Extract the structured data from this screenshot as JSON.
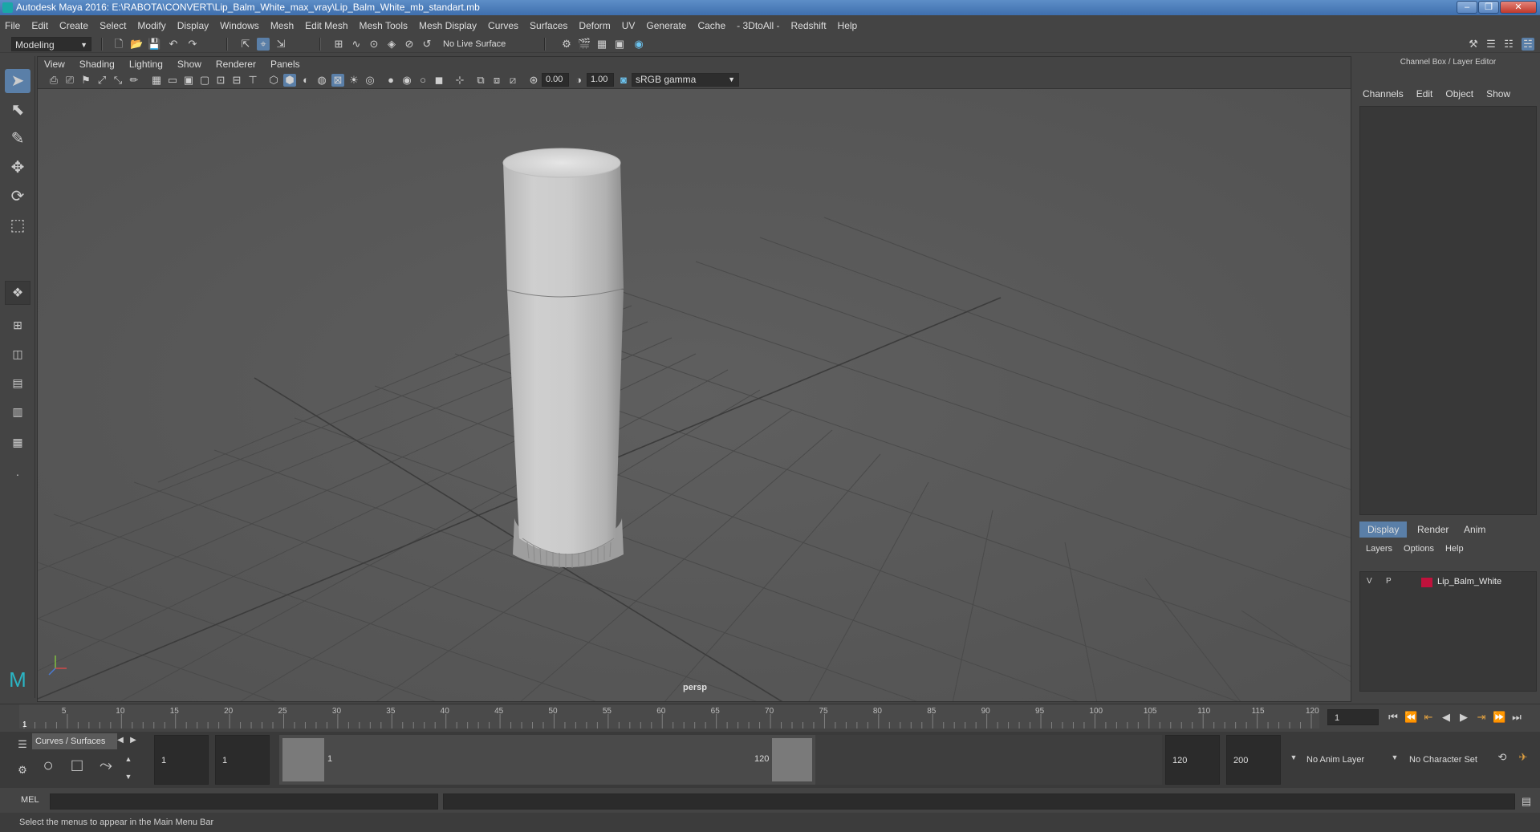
{
  "window": {
    "title": "Autodesk Maya 2016: E:\\RABOTA\\CONVERT\\Lip_Balm_White_max_vray\\Lip_Balm_White_mb_standart.mb"
  },
  "menubar": [
    "File",
    "Edit",
    "Create",
    "Select",
    "Modify",
    "Display",
    "Windows",
    "Mesh",
    "Edit Mesh",
    "Mesh Tools",
    "Mesh Display",
    "Curves",
    "Surfaces",
    "Deform",
    "UV",
    "Generate",
    "Cache",
    "- 3DtoAll -",
    "Redshift",
    "Help"
  ],
  "statusline": {
    "mode": "Modeling",
    "live_surface": "No Live Surface"
  },
  "panel": {
    "menus": [
      "View",
      "Shading",
      "Lighting",
      "Show",
      "Renderer",
      "Panels"
    ],
    "exposure": "0.00",
    "gamma": "1.00",
    "colorspace": "sRGB gamma",
    "camera_label": "persp"
  },
  "channelbox": {
    "header": "Channel Box / Layer Editor",
    "menus": [
      "Channels",
      "Edit",
      "Object",
      "Show"
    ]
  },
  "layers": {
    "tabs": [
      "Display",
      "Render",
      "Anim"
    ],
    "menus": [
      "Layers",
      "Options",
      "Help"
    ],
    "items": [
      {
        "v": "V",
        "p": "P",
        "name": "Lip_Balm_White",
        "color": "#c0123c"
      }
    ]
  },
  "timeline": {
    "ticks": [
      "1",
      "5",
      "10",
      "15",
      "20",
      "25",
      "30",
      "35",
      "40",
      "45",
      "50",
      "55",
      "60",
      "65",
      "70",
      "75",
      "80",
      "85",
      "90",
      "95",
      "100",
      "105",
      "110",
      "115",
      "120"
    ],
    "current_frame": "1"
  },
  "range": {
    "shelf_label": "Curves / Surfaces",
    "start": "1",
    "start2": "1",
    "range_start": "1",
    "range_end": "120",
    "end": "120",
    "end2": "200",
    "anim_layer": "No Anim Layer",
    "char_set": "No Character Set"
  },
  "cmdline": {
    "label": "MEL"
  },
  "helpline": {
    "text": "Select the menus to appear in the Main Menu Bar"
  }
}
